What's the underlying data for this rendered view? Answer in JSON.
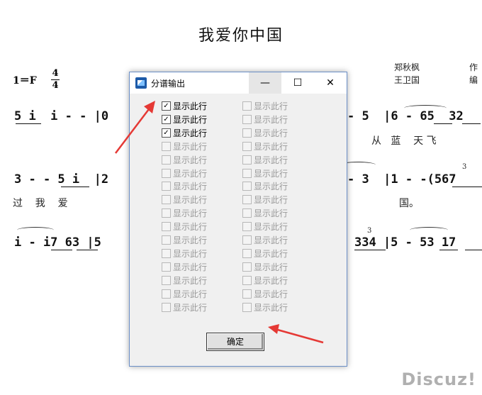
{
  "score": {
    "title": "我爱你中国",
    "key": "1＝F",
    "time_top": "4",
    "time_bottom": "4",
    "credit_name_1": "郑秋枫",
    "credit_role_1": "作",
    "credit_name_2": "王卫国",
    "credit_role_2": "编",
    "row1_left": "5 i  i - - |0",
    "row1_right": "- 5  |6 - 65  32",
    "row1_lyr_right": "从   蓝    天 飞",
    "row2_left": "3 - - 5 i  |2",
    "row2_right": "- 3  |1 - -(567",
    "row2_lyr_left": "过    我    爱",
    "row2_lyr_right": "国。",
    "row3_left": "i - i7 63 |5",
    "row3_right": "334 |5 - 53 17",
    "triplet": "3",
    "watermark": "Discuz!"
  },
  "dialog": {
    "title": "分谱输出",
    "min_glyph": "—",
    "max_glyph": "☐",
    "close_glyph": "✕",
    "checkbox_label": "显示此行",
    "check_glyph": "✓",
    "left_column": [
      {
        "label": "显示此行",
        "checked": true,
        "enabled": true
      },
      {
        "label": "显示此行",
        "checked": true,
        "enabled": true
      },
      {
        "label": "显示此行",
        "checked": true,
        "enabled": true
      },
      {
        "label": "显示此行",
        "checked": false,
        "enabled": false
      },
      {
        "label": "显示此行",
        "checked": false,
        "enabled": false
      },
      {
        "label": "显示此行",
        "checked": false,
        "enabled": false
      },
      {
        "label": "显示此行",
        "checked": false,
        "enabled": false
      },
      {
        "label": "显示此行",
        "checked": false,
        "enabled": false
      },
      {
        "label": "显示此行",
        "checked": false,
        "enabled": false
      },
      {
        "label": "显示此行",
        "checked": false,
        "enabled": false
      },
      {
        "label": "显示此行",
        "checked": false,
        "enabled": false
      },
      {
        "label": "显示此行",
        "checked": false,
        "enabled": false
      },
      {
        "label": "显示此行",
        "checked": false,
        "enabled": false
      },
      {
        "label": "显示此行",
        "checked": false,
        "enabled": false
      },
      {
        "label": "显示此行",
        "checked": false,
        "enabled": false
      },
      {
        "label": "显示此行",
        "checked": false,
        "enabled": false
      }
    ],
    "right_column": [
      {
        "label": "显示此行",
        "checked": false,
        "enabled": false
      },
      {
        "label": "显示此行",
        "checked": false,
        "enabled": false
      },
      {
        "label": "显示此行",
        "checked": false,
        "enabled": false
      },
      {
        "label": "显示此行",
        "checked": false,
        "enabled": false
      },
      {
        "label": "显示此行",
        "checked": false,
        "enabled": false
      },
      {
        "label": "显示此行",
        "checked": false,
        "enabled": false
      },
      {
        "label": "显示此行",
        "checked": false,
        "enabled": false
      },
      {
        "label": "显示此行",
        "checked": false,
        "enabled": false
      },
      {
        "label": "显示此行",
        "checked": false,
        "enabled": false
      },
      {
        "label": "显示此行",
        "checked": false,
        "enabled": false
      },
      {
        "label": "显示此行",
        "checked": false,
        "enabled": false
      },
      {
        "label": "显示此行",
        "checked": false,
        "enabled": false
      },
      {
        "label": "显示此行",
        "checked": false,
        "enabled": false
      },
      {
        "label": "显示此行",
        "checked": false,
        "enabled": false
      },
      {
        "label": "显示此行",
        "checked": false,
        "enabled": false
      },
      {
        "label": "显示此行",
        "checked": false,
        "enabled": false
      }
    ],
    "ok_label": "确定",
    "accent_color": "#6b8fc7",
    "annotation_arrow_color": "#e53935"
  }
}
